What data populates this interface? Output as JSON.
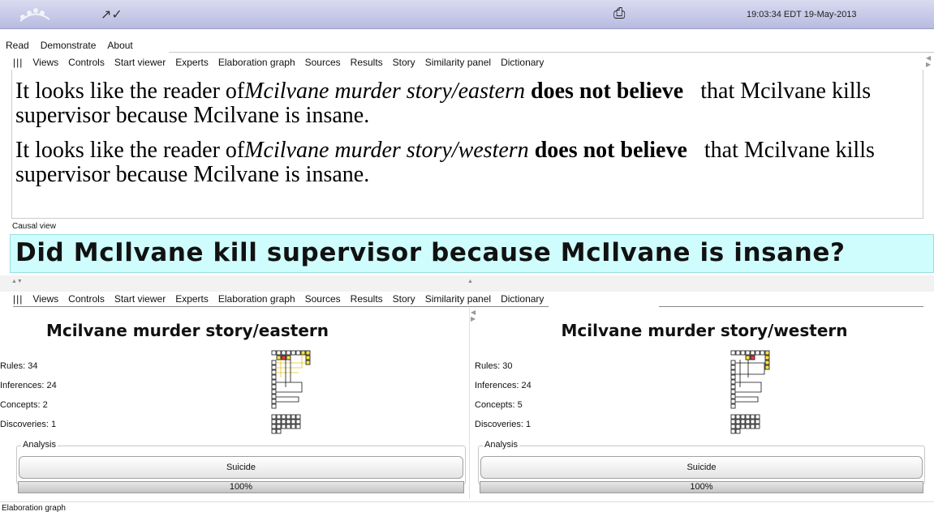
{
  "titlebar": {
    "clock": "19:03:34 EDT 19-May-2013",
    "icons": [
      "logo-icon",
      "share-icon",
      "printer-icon"
    ]
  },
  "main_menu": [
    "Read",
    "Demonstrate",
    "About"
  ],
  "tabs": [
    "|||",
    "Views",
    "Controls",
    "Start viewer",
    "Experts",
    "Elaboration graph",
    "Sources",
    "Results",
    "Story",
    "Similarity panel",
    "Dictionary"
  ],
  "causal_view": {
    "label": "Causal view",
    "paragraphs": [
      {
        "prefix": "It looks like the reader of",
        "story": "Mcilvane murder story/eastern",
        "verdict": "does not believe",
        "suffix": "that Mcilvane kills supervisor because Mcilvane is insane."
      },
      {
        "prefix": "It looks like the reader of",
        "story": "Mcilvane murder story/western",
        "verdict": "does not believe",
        "suffix": "that Mcilvane kills supervisor because Mcilvane is insane."
      }
    ]
  },
  "question": "Did McIlvane kill supervisor because McIlvane is insane?",
  "stories": [
    {
      "title": "Mcilvane murder story/eastern",
      "stats": [
        "Rules: 34",
        "Inferences: 24",
        "Concepts: 2",
        "Discoveries: 1"
      ],
      "analysis_label": "Analysis",
      "button": "Suicide",
      "progress_text": "100%",
      "progress": 1.0
    },
    {
      "title": "Mcilvane murder story/western",
      "stats": [
        "Rules: 30",
        "Inferences: 24",
        "Concepts: 5",
        "Discoveries: 1"
      ],
      "analysis_label": "Analysis",
      "button": "Suicide",
      "progress_text": "100%",
      "progress": 1.0
    }
  ],
  "footer": "Elaboration graph",
  "colors": {
    "titlebar": "#c4c7e6",
    "question_bg": "#cffcfc",
    "graph_yellow": "#f4e04a",
    "graph_red": "#e0414a"
  }
}
